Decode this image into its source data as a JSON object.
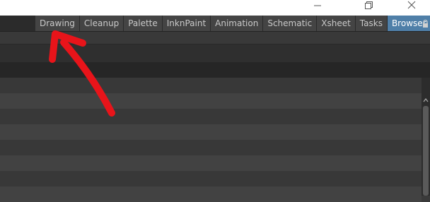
{
  "window_controls": {
    "minimize_icon": "minimize-icon",
    "restore_icon": "restore-icon",
    "close_icon": "close-icon"
  },
  "rooms": {
    "tabs": [
      {
        "label": "Drawing"
      },
      {
        "label": "Cleanup"
      },
      {
        "label": "Palette"
      },
      {
        "label": "InknPaint"
      },
      {
        "label": "Animation"
      },
      {
        "label": "Schematic"
      },
      {
        "label": "Xsheet"
      },
      {
        "label": "Tasks"
      },
      {
        "label": "Browser",
        "active": true
      }
    ],
    "lock_icon": "lock-icon"
  },
  "colors": {
    "active_tab": "#4f7fa8",
    "annotation_arrow": "#e8141a"
  }
}
